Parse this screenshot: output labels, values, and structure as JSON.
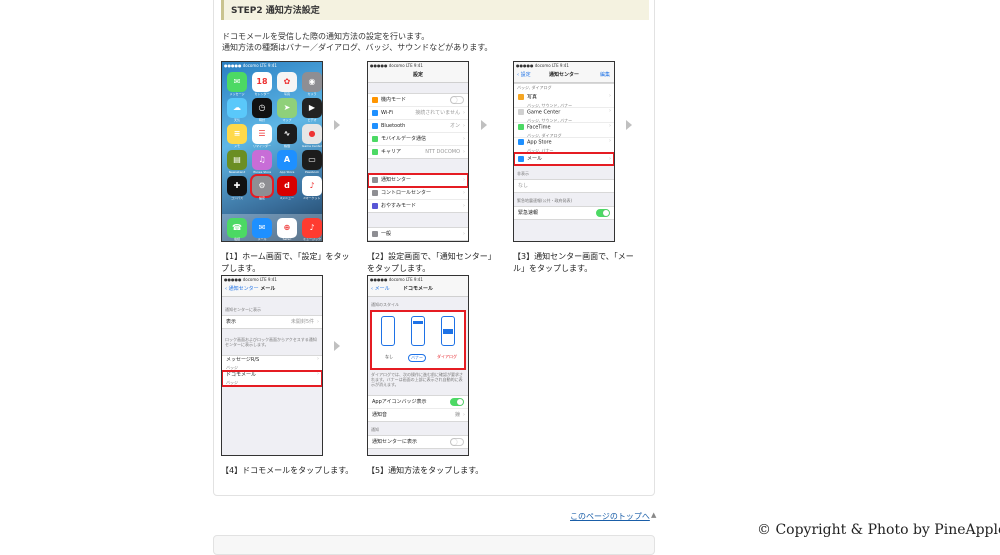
{
  "step": {
    "title": "STEP2 通知方法設定",
    "intro": [
      "ドコモメールを受信した際の通知方法の設定を行います。",
      "通知方法の種類はバナー／ダイアログ、バッジ、サウンドなどがあります。"
    ]
  },
  "status_bar": "●●●●● docomo  LTE   9:41",
  "captions": [
    [
      "【1】ホーム画面で、「設定」をタッ",
      "プします。"
    ],
    [
      "【2】設定画面で、「通知センター」",
      "をタップします。"
    ],
    [
      "【3】通知センター画面で、「メー",
      "ル」をタップします。"
    ],
    [
      "【4】ドコモメールをタップします。"
    ],
    [
      "【5】通知方法をタップします。"
    ]
  ],
  "screen1": {
    "apps": [
      {
        "label": "メッセージ",
        "color": "#4cd964",
        "icon": "message-icon",
        "glyph": "✉"
      },
      {
        "label": "カレンダー",
        "color": "#ffffff",
        "icon": "calendar-icon",
        "glyph": "18"
      },
      {
        "label": "写真",
        "color": "#f5f5f5",
        "icon": "photos-icon",
        "glyph": "✿"
      },
      {
        "label": "カメラ",
        "color": "#8e8e93",
        "icon": "camera-icon",
        "glyph": "◉"
      },
      {
        "label": "天気",
        "color": "#5ac8fa",
        "icon": "weather-icon",
        "glyph": "☁"
      },
      {
        "label": "時計",
        "color": "#111111",
        "icon": "clock-icon",
        "glyph": "◷"
      },
      {
        "label": "マップ",
        "color": "#8fd07a",
        "icon": "maps-icon",
        "glyph": "➤"
      },
      {
        "label": "ビデオ",
        "color": "#222222",
        "icon": "videos-icon",
        "glyph": "▶"
      },
      {
        "label": "メモ",
        "color": "#ffd94a",
        "icon": "notes-icon",
        "glyph": "≡"
      },
      {
        "label": "リマインダー",
        "color": "#ffffff",
        "icon": "reminders-icon",
        "glyph": "☰"
      },
      {
        "label": "株価",
        "color": "#1c1c1c",
        "icon": "stocks-icon",
        "glyph": "∿"
      },
      {
        "label": "Game Center",
        "color": "#e6e6e6",
        "icon": "game-center-icon",
        "glyph": "●"
      },
      {
        "label": "Newsstand",
        "color": "#6b8e23",
        "icon": "newsstand-icon",
        "glyph": "▤"
      },
      {
        "label": "iTunes Store",
        "color": "#c86dd7",
        "icon": "itunes-icon",
        "glyph": "♫"
      },
      {
        "label": "App Store",
        "color": "#1e90ff",
        "icon": "app-store-icon",
        "glyph": "A"
      },
      {
        "label": "Passbook",
        "color": "#1c1c1c",
        "icon": "passbook-icon",
        "glyph": "▭"
      },
      {
        "label": "コンパス",
        "color": "#111111",
        "icon": "compass-icon",
        "glyph": "✚"
      },
      {
        "label": "設定",
        "color": "#8e8e93",
        "icon": "settings-icon",
        "glyph": "⚙",
        "highlight": true
      },
      {
        "label": "dメニュー",
        "color": "#d90000",
        "icon": "d-menu-icon",
        "glyph": "d"
      },
      {
        "label": "dマーケット",
        "color": "#ffffff",
        "icon": "d-market-icon",
        "glyph": "♪"
      }
    ],
    "dock": [
      {
        "label": "電話",
        "color": "#4cd964",
        "icon": "phone-icon",
        "glyph": "☎"
      },
      {
        "label": "メール",
        "color": "#1e90ff",
        "icon": "mail-icon",
        "glyph": "✉"
      },
      {
        "label": "Safari",
        "color": "#ffffff",
        "icon": "safari-icon",
        "glyph": "⊕"
      },
      {
        "label": "ミュージック",
        "color": "#ff3b30",
        "icon": "music-icon",
        "glyph": "♪"
      }
    ]
  },
  "screen2": {
    "title": "設定",
    "rows": [
      {
        "label": "機内モード",
        "color": "#ff9500",
        "icon": "airplane-icon",
        "toggle": "off"
      },
      {
        "label": "Wi-Fi",
        "color": "#1e90ff",
        "icon": "wifi-icon",
        "value": "接続されていません"
      },
      {
        "label": "Bluetooth",
        "color": "#1e90ff",
        "icon": "bluetooth-icon",
        "value": "オン"
      },
      {
        "label": "モバイルデータ通信",
        "color": "#4cd964",
        "icon": "cellular-icon"
      },
      {
        "label": "キャリア",
        "color": "#4cd964",
        "icon": "carrier-icon",
        "value": "NTT DOCOMO"
      }
    ],
    "rows2": [
      {
        "label": "通知センター",
        "color": "#8e8e93",
        "icon": "notification-center-icon",
        "highlight": true
      },
      {
        "label": "コントロールセンター",
        "color": "#8e8e93",
        "icon": "control-center-icon"
      },
      {
        "label": "おやすみモード",
        "color": "#5856d6",
        "icon": "do-not-disturb-icon"
      }
    ],
    "rows3": [
      {
        "label": "一般",
        "color": "#8e8e93",
        "icon": "general-icon"
      }
    ]
  },
  "screen3": {
    "back": "設定",
    "title": "通知センター",
    "edit": "編集",
    "top_sub": "バッジ, ダイアログ",
    "rows": [
      {
        "label": "写真",
        "sub": "バッジ, サウンド, バナー",
        "color": "#f5a623",
        "icon": "photos-icon"
      },
      {
        "label": "Game Center",
        "sub": "バッジ, サウンド, バナー",
        "color": "#d0d0d0",
        "icon": "game-center-icon"
      },
      {
        "label": "FaceTime",
        "sub": "バッジ, ダイアログ",
        "color": "#4cd964",
        "icon": "facetime-icon"
      },
      {
        "label": "App Store",
        "sub": "バッジ, バナー",
        "color": "#1e90ff",
        "icon": "app-store-icon"
      },
      {
        "label": "メール",
        "sub": "",
        "color": "#1e90ff",
        "icon": "mail-icon",
        "highlight": true
      }
    ],
    "sec_hidden": "非表示",
    "none": "なし",
    "sec_emergency": "緊急地震速報(公共・政府発表)",
    "emergency": "緊急速報"
  },
  "screen4": {
    "back": "通知センター",
    "title": "メール",
    "sec_show": "通知センターに表示",
    "show_label": "表示",
    "show_value": "未開封5件",
    "note": "ロック画面およびロック画面からアクセスする通知センターに表示します。",
    "rows": [
      {
        "label": "メッセージR/S",
        "sub": "バッジ"
      },
      {
        "label": "ドコモメール",
        "sub": "バッジ",
        "highlight": true
      }
    ]
  },
  "screen5": {
    "back": "メール",
    "title": "ドコモメール",
    "sec_style": "通知のスタイル",
    "styles": [
      "なし",
      "バナー",
      "ダイアログ"
    ],
    "note": "ダイアログでは、次の操作に進む前に確認が要求されます。バナーは画面の上部に表示され自動的に表示が消えます。",
    "badge": "Appアイコンバッジ表示",
    "sound": "通知音",
    "sound_value": "鐘",
    "sec_notif": "通知",
    "notif_show": "通知センターに表示"
  },
  "footer": {
    "top_link": "このページのトップへ",
    "copyright": "© Copyright & Photo by PineApple"
  }
}
